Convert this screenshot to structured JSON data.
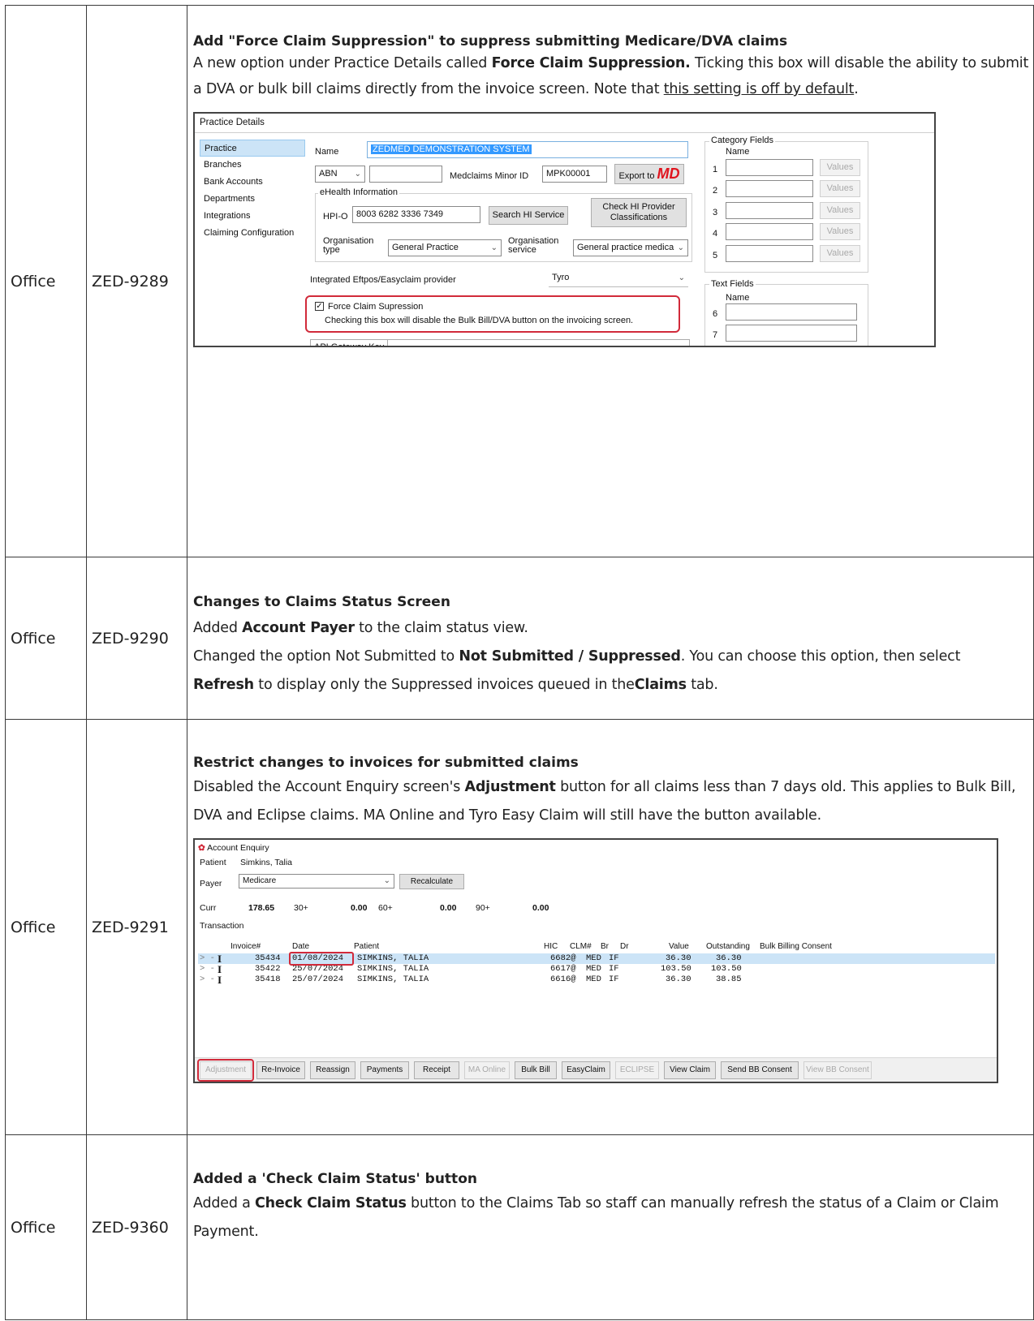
{
  "rows": [
    {
      "area": "Office",
      "ticket": "ZED-9289",
      "title": "Add \"Force Claim Suppression\" to suppress submitting Medicare/DVA claims",
      "desc_a": "A new option under Practice Details called ",
      "desc_b": "Force Claim Suppression.",
      "desc_c": " Ticking this box will disable the ability to submit a DVA or bulk bill claims directly from the invoice screen. Note that ",
      "desc_d": "this setting is off by default",
      "desc_e": "."
    },
    {
      "area": "Office",
      "ticket": "ZED-9290",
      "title": "Changes to Claims Status Screen",
      "l1_a": "Added ",
      "l1_b": "Account Payer",
      "l1_c": " to the claim status view.",
      "l2_a": "Changed the option Not Submitted to ",
      "l2_b": "Not Submitted / Suppressed",
      "l2_c": ". You can choose this option, then select",
      "l3_a": "Refresh",
      "l3_b": " to display only the Suppressed invoices queued in the",
      "l3_c": "Claims",
      "l3_d": " tab."
    },
    {
      "area": "Office",
      "ticket": "ZED-9291",
      "title": "Restrict changes to invoices for submitted claims",
      "desc_a": "Disabled the Account Enquiry screen's ",
      "desc_b": "Adjustment",
      "desc_c": " button for all claims less than 7 days old. This applies to Bulk Bill, DVA and Eclipse claims. MA Online and Tyro Easy Claim will still have the button available."
    },
    {
      "area": "Office",
      "ticket": "ZED-9360",
      "title": "Added a 'Check Claim Status' button",
      "desc_a": "Added a ",
      "desc_b": "Check Claim Status",
      "desc_c": " button to the Claims Tab so staff can manually refresh the status of a Claim or Claim Payment."
    }
  ],
  "practice": {
    "window_title": "Practice Details",
    "nav": [
      "Practice",
      "Branches",
      "Bank Accounts",
      "Departments",
      "Integrations",
      "Claiming Configuration"
    ],
    "name_label": "Name",
    "name_value": "ZEDMED DEMONSTRATION SYSTEM",
    "abn_label": "ABN",
    "minor_label": "Medclaims Minor ID",
    "minor_value": "MPK00001",
    "export_label": "Export to",
    "export_logo": "MD",
    "ehealth_label": "eHealth Information",
    "hpio_label": "HPI-O",
    "hpio_value": "8003 6282 3336 7349",
    "search_hi": "Search HI Service",
    "check_hi_1": "Check HI Provider",
    "check_hi_2": "Classifications",
    "org_type_1": "Organisation",
    "org_type_2": "type",
    "org_type_value": "General Practice",
    "org_service_1": "Organisation",
    "org_service_2": "service",
    "org_service_value": "General practice medica",
    "eftpos_label": "Integrated Eftpos/Easyclaim provider",
    "eftpos_value": "Tyro",
    "force_label": "Force Claim Supression",
    "force_note": "Checking this box will disable the Bulk Bill/DVA button on the invoicing screen.",
    "api_label": "API Gateway Key",
    "category_label": "Category Fields",
    "category_name": "Name",
    "values_label": "Values",
    "cat_nums": [
      "1",
      "2",
      "3",
      "4",
      "5"
    ],
    "text_label": "Text Fields",
    "text_name": "Name",
    "text_nums": [
      "6",
      "7"
    ]
  },
  "enquiry": {
    "window_title": "Account Enquiry",
    "patient_label": "Patient",
    "patient_value": "Simkins, Talia",
    "payer_label": "Payer",
    "payer_value": "Medicare",
    "recalc": "Recalculate",
    "curr_label": "Curr",
    "curr_value": "178.65",
    "b30_label": "30+",
    "b30_value": "0.00",
    "b60_label": "60+",
    "b60_value": "0.00",
    "b90_label": "90+",
    "b90_value": "0.00",
    "transaction_label": "Transaction",
    "columns": [
      "Invoice#",
      "Date",
      "Patient",
      "HIC",
      "CLM#",
      "Br",
      "Dr",
      "Value",
      "Outstanding",
      "Bulk Billing Consent"
    ],
    "rows": [
      {
        "inv": "35434",
        "date": "01/08/2024",
        "patient": "SIMKINS, TALIA",
        "clm": "6682@",
        "br": "MED",
        "dr": "IF",
        "value": "36.30",
        "out": "36.30"
      },
      {
        "inv": "35422",
        "date": "25/07/2024",
        "patient": "SIMKINS, TALIA",
        "clm": "6617@",
        "br": "MED",
        "dr": "IF",
        "value": "103.50",
        "out": "103.50"
      },
      {
        "inv": "35418",
        "date": "25/07/2024",
        "patient": "SIMKINS, TALIA",
        "clm": "6616@",
        "br": "MED",
        "dr": "IF",
        "value": "36.30",
        "out": "38.85"
      }
    ],
    "row_marker": "I",
    "row_arrow": "> -",
    "buttons": [
      "Adjustment",
      "Re-Invoice",
      "Reassign",
      "Payments",
      "Receipt",
      "MA Online",
      "Bulk Bill",
      "EasyClaim",
      "ECLIPSE",
      "View Claim",
      "Send BB Consent",
      "View BB Consent"
    ]
  },
  "colors": {
    "highlight": "#d12a3a",
    "selection": "#cce4f7",
    "logo_red": "#e0141e"
  }
}
